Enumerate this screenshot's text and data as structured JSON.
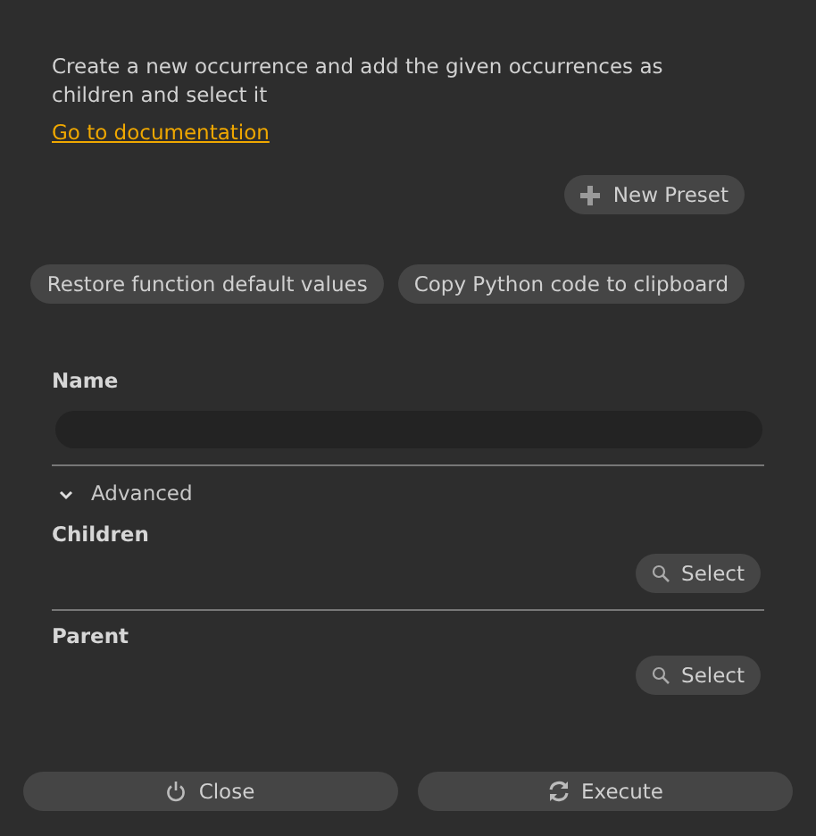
{
  "description": "Create a new occurrence and add the given occurrences as children and select it",
  "doc_link": "Go to documentation",
  "preset_button": "New Preset",
  "actions": [
    "Restore function default values",
    "Copy Python code to clipboard"
  ],
  "name_field": {
    "label": "Name"
  },
  "advanced": {
    "label": "Advanced",
    "expanded": true,
    "fields": [
      {
        "label": "Children",
        "button": "Select"
      },
      {
        "label": "Parent",
        "button": "Select"
      }
    ]
  },
  "footer": [
    {
      "kind": "close",
      "label": "Close"
    },
    {
      "kind": "execute",
      "label": "Execute"
    }
  ]
}
